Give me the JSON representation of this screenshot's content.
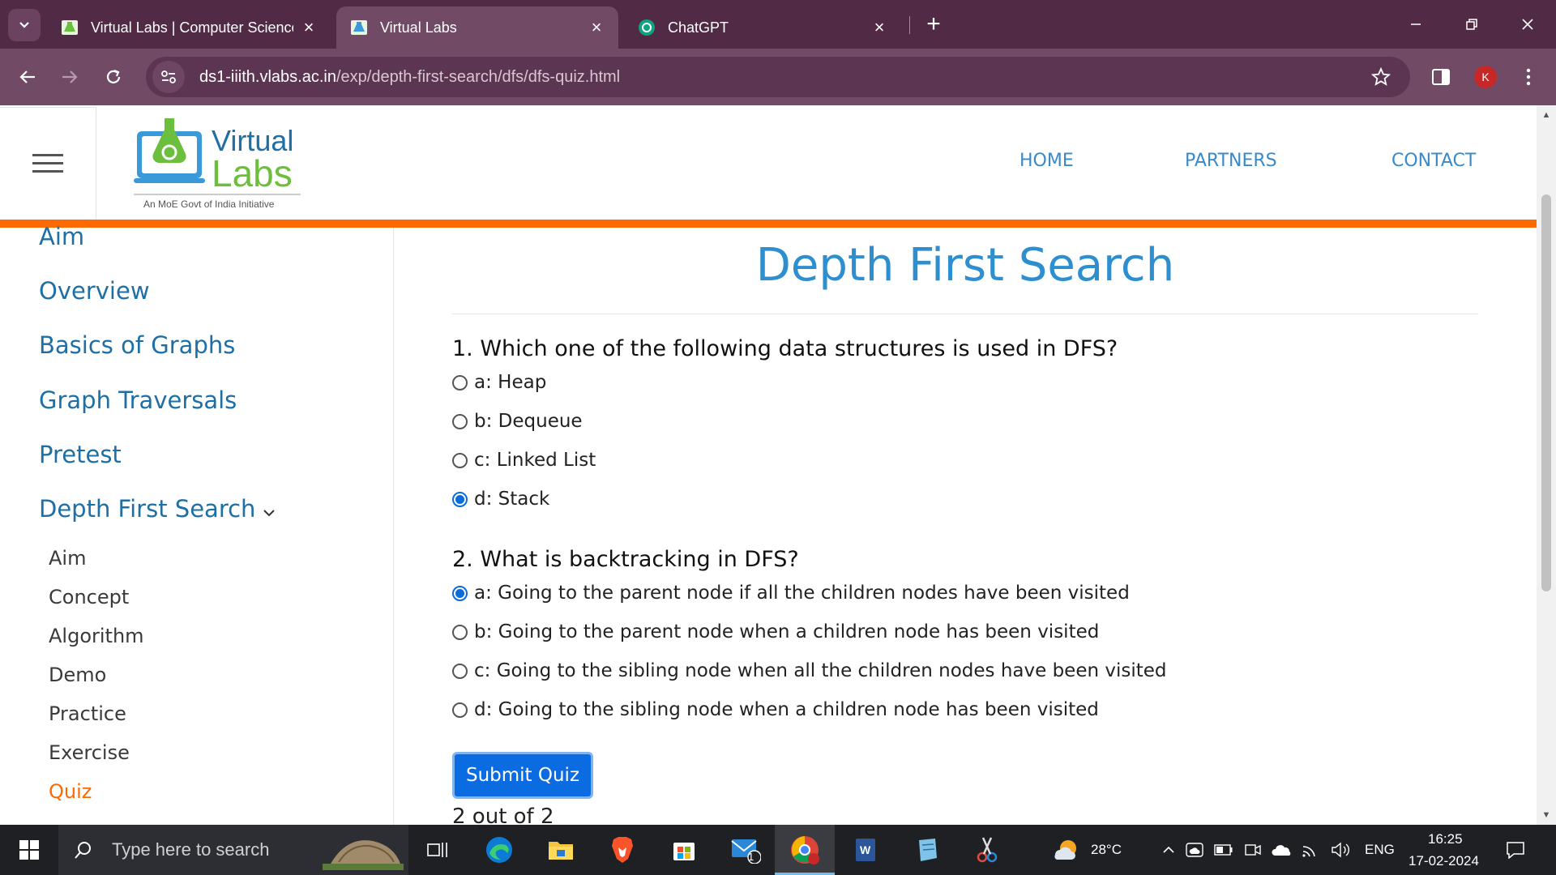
{
  "browser": {
    "tabs": [
      {
        "title": "Virtual Labs | Computer Science",
        "active": false
      },
      {
        "title": "Virtual Labs",
        "active": true
      },
      {
        "title": "ChatGPT",
        "active": false
      }
    ],
    "url_host": "ds1-iiith.vlabs.ac.in",
    "url_path": "/exp/depth-first-search/dfs/dfs-quiz.html",
    "profile_initial": "K",
    "accent_color": "#714a66"
  },
  "site": {
    "logo_text_1": "Virtual",
    "logo_text_2": "Labs",
    "logo_tagline": "An MoE Govt of India Initiative",
    "nav": [
      "HOME",
      "PARTNERS",
      "CONTACT"
    ]
  },
  "sidebar": {
    "items": [
      "Aim",
      "Overview",
      "Basics of Graphs",
      "Graph Traversals",
      "Pretest",
      "Depth First Search"
    ],
    "subitems": [
      "Aim",
      "Concept",
      "Algorithm",
      "Demo",
      "Practice",
      "Exercise",
      "Quiz"
    ],
    "active_subitem": "Quiz"
  },
  "quiz": {
    "title": "Depth First Search",
    "questions": [
      {
        "text": "1. Which one of the following data structures is used in DFS?",
        "options": [
          "a: Heap",
          "b: Dequeue",
          "c: Linked List",
          "d: Stack"
        ],
        "selected": "d: Stack"
      },
      {
        "text": "2. What is backtracking in DFS?",
        "options": [
          "a: Going to the parent node if all the children nodes have been visited",
          "b: Going to the parent node when a children node has been visited",
          "c: Going to the sibling node when all the children nodes have been visited",
          "d: Going to the sibling node when a children node has been visited"
        ],
        "selected": "a: Going to the parent node if all the children nodes have been visited"
      }
    ],
    "submit_label": "Submit Quiz",
    "score_text": "2 out of 2"
  },
  "taskbar": {
    "search_placeholder": "Type here to search",
    "temperature": "28°C",
    "language": "ENG",
    "time": "16:25",
    "date": "17-02-2024",
    "mail_badge": "1"
  }
}
